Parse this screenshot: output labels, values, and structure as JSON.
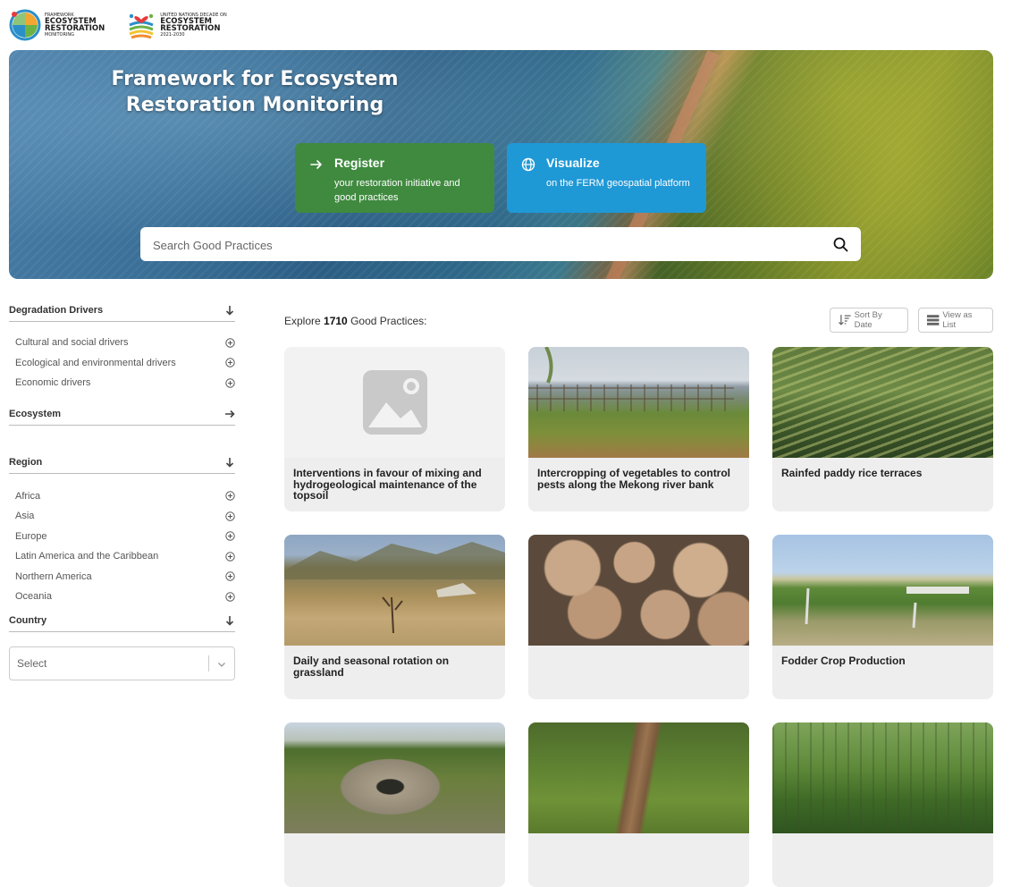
{
  "logos": {
    "ferm": {
      "line1": "FRAMEWORK",
      "line2": "ECOSYSTEM",
      "line3": "RESTORATION",
      "line4": "MONITORING"
    },
    "un_decade": {
      "line1": "UNITED NATIONS DECADE ON",
      "line2": "ECOSYSTEM",
      "line3": "RESTORATION",
      "line4": "2021-2030"
    }
  },
  "hero": {
    "title": "Framework for Ecosystem Restoration Monitoring",
    "register": {
      "title": "Register",
      "subtitle": "your restoration initiative and good practices"
    },
    "visualize": {
      "title": "Visualize",
      "subtitle": "on the FERM geospatial platform"
    },
    "search_placeholder": "Search Good Practices"
  },
  "sidebar": {
    "degradation": {
      "label": "Degradation Drivers",
      "items": [
        "Cultural and social drivers",
        "Ecological and environmental drivers",
        "Economic drivers"
      ]
    },
    "ecosystem": {
      "label": "Ecosystem"
    },
    "region": {
      "label": "Region",
      "items": [
        "Africa",
        "Asia",
        "Europe",
        "Latin America and the Caribbean",
        "Northern America",
        "Oceania"
      ]
    },
    "country": {
      "label": "Country",
      "select_placeholder": "Select"
    }
  },
  "main": {
    "explore_prefix": "Explore",
    "count": "1710",
    "explore_suffix": "Good Practices:",
    "sort_label": "Sort By Date",
    "view_label": "View as List",
    "cards": [
      {
        "title": "Interventions in favour of mixing and hydrogeological maintenance of the topsoil",
        "image": "placeholder-image-icon"
      },
      {
        "title": "Intercropping of vegetables to control pests along the Mekong river bank",
        "image": "mekong-riverbank-photo"
      },
      {
        "title": "Rainfed paddy rice terraces",
        "image": "rice-terraces-photo"
      },
      {
        "title": "Daily and seasonal rotation on grassland",
        "image": "grassland-rotation-photo"
      },
      {
        "title": "",
        "image": "sprouting-potatoes-photo"
      },
      {
        "title": "Fodder Crop Production",
        "image": "fodder-field-photo"
      },
      {
        "title": "",
        "image": "stone-well-photo"
      },
      {
        "title": "",
        "image": "irrigation-channel-photo"
      },
      {
        "title": "",
        "image": "forest-stream-photo"
      }
    ]
  },
  "colors": {
    "register_green": "#3f8a3f",
    "visualize_blue": "#1f98d6",
    "card_bg": "#eeeeee"
  }
}
